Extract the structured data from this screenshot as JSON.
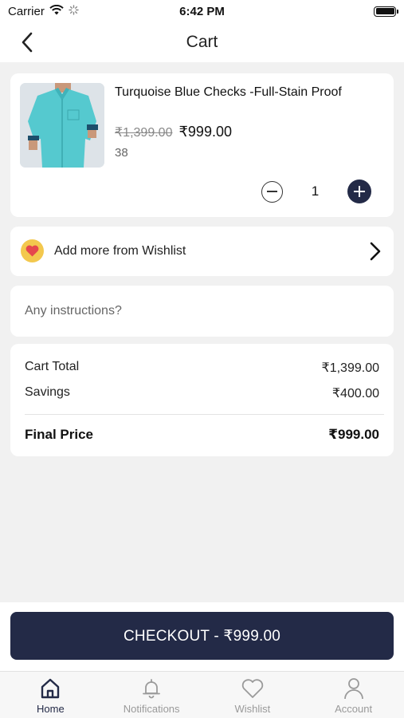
{
  "status_bar": {
    "carrier": "Carrier",
    "time": "6:42 PM"
  },
  "header": {
    "title": "Cart"
  },
  "cart_item": {
    "name": "Turquoise Blue Checks -Full-Stain Proof",
    "original_price": "₹1,399.00",
    "price": "₹999.00",
    "size": "38",
    "quantity": "1"
  },
  "wishlist_prompt": {
    "label": "Add more from Wishlist"
  },
  "instructions": {
    "placeholder": "Any instructions?",
    "value": ""
  },
  "summary": {
    "cart_total_label": "Cart Total",
    "cart_total_value": "₹1,399.00",
    "savings_label": "Savings",
    "savings_value": "₹400.00",
    "final_label": "Final Price",
    "final_value": "₹999.00"
  },
  "checkout": {
    "label": "CHECKOUT - ₹999.00"
  },
  "tabs": [
    {
      "label": "Home",
      "icon": "home-icon",
      "active": true
    },
    {
      "label": "Notifications",
      "icon": "bell-icon",
      "active": false
    },
    {
      "label": "Wishlist",
      "icon": "heart-icon",
      "active": false
    },
    {
      "label": "Account",
      "icon": "user-icon",
      "active": false
    }
  ],
  "colors": {
    "primary": "#232a47",
    "background": "#f1f1f1",
    "wishlist_badge": "#f3c84e",
    "wishlist_heart": "#e5484d"
  }
}
